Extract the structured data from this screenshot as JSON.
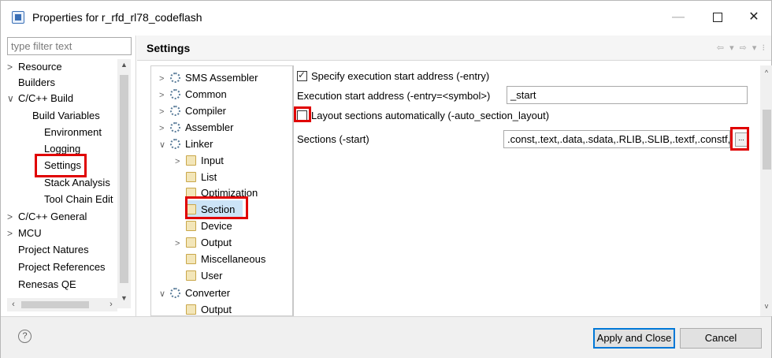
{
  "window": {
    "title": "Properties for r_rfd_rl78_codeflash",
    "minimize": "—",
    "close": "✕"
  },
  "filter": {
    "placeholder": "type filter text"
  },
  "nav": {
    "items": [
      {
        "label": "Resource",
        "arrow": ">"
      },
      {
        "label": "Builders",
        "arrow": ""
      },
      {
        "label": "C/C++ Build",
        "arrow": "∨"
      },
      {
        "label": "Build Variables",
        "arrow": ""
      },
      {
        "label": "Environment",
        "arrow": ""
      },
      {
        "label": "Logging",
        "arrow": ""
      },
      {
        "label": "Settings",
        "arrow": ""
      },
      {
        "label": "Stack Analysis",
        "arrow": ""
      },
      {
        "label": "Tool Chain Edit",
        "arrow": ""
      },
      {
        "label": "C/C++ General",
        "arrow": ">"
      },
      {
        "label": "MCU",
        "arrow": ">"
      },
      {
        "label": "Project Natures",
        "arrow": ""
      },
      {
        "label": "Project References",
        "arrow": ""
      },
      {
        "label": "Renesas QE",
        "arrow": ""
      }
    ]
  },
  "settings": {
    "title": "Settings",
    "nav_arrows": "⇦ ▾ ⇨ ▾ ⁝"
  },
  "tool_tree": {
    "items": [
      {
        "label": "SMS Assembler",
        "arrow": ">",
        "icon": "gear"
      },
      {
        "label": "Common",
        "arrow": ">",
        "icon": "gear"
      },
      {
        "label": "Compiler",
        "arrow": ">",
        "icon": "gear"
      },
      {
        "label": "Assembler",
        "arrow": ">",
        "icon": "gear"
      },
      {
        "label": "Linker",
        "arrow": "∨",
        "icon": "gear"
      },
      {
        "label": "Input",
        "arrow": ">",
        "icon": "page"
      },
      {
        "label": "List",
        "arrow": "",
        "icon": "page"
      },
      {
        "label": "Optimization",
        "arrow": "",
        "icon": "page"
      },
      {
        "label": "Section",
        "arrow": "",
        "icon": "page"
      },
      {
        "label": "Device",
        "arrow": "",
        "icon": "page"
      },
      {
        "label": "Output",
        "arrow": ">",
        "icon": "page"
      },
      {
        "label": "Miscellaneous",
        "arrow": "",
        "icon": "page"
      },
      {
        "label": "User",
        "arrow": "",
        "icon": "page"
      },
      {
        "label": "Converter",
        "arrow": "∨",
        "icon": "gear"
      },
      {
        "label": "Output",
        "arrow": "",
        "icon": "page"
      }
    ]
  },
  "options": {
    "entry_checkbox_label": "Specify execution start address (-entry)",
    "entry_checked": true,
    "entry_label": "Execution start address (-entry=<symbol>)",
    "entry_value": "_start",
    "layout_checkbox_label": "Layout sections automatically (-auto_section_layout)",
    "layout_checked": false,
    "sections_label": "Sections (-start)",
    "sections_value": ".const,.text,.data,.sdata,.RLIB,.SLIB,.textf,.constf,",
    "ellipsis": "..."
  },
  "footer": {
    "help": "?",
    "apply_label": "Apply and Close",
    "cancel_label": "Cancel"
  },
  "colors": {
    "highlight": "#e00000",
    "selection": "#cce4f7",
    "accent": "#0078d7"
  }
}
